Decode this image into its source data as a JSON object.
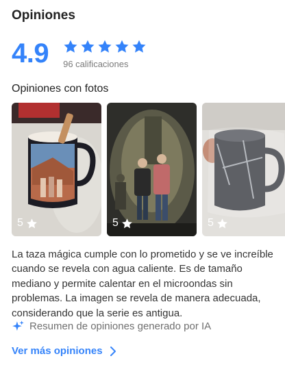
{
  "header": {
    "title": "Opiniones"
  },
  "rating": {
    "value": "4.9",
    "count_label": "96 calificaciones",
    "stars_filled": 5,
    "stars_total": 5,
    "star_color": "#3483fa"
  },
  "photos_section": {
    "title": "Opiniones con fotos",
    "photos": [
      {
        "rating": "5",
        "icon": "star-icon",
        "description_icon": "mug-photo"
      },
      {
        "rating": "5",
        "icon": "star-icon",
        "description_icon": "people-photo"
      },
      {
        "rating": "5",
        "icon": "star-icon",
        "description_icon": "wrapped-mug-photo"
      }
    ]
  },
  "review": {
    "text": "La taza mágica cumple con lo prometido y se ve increíble cuando se revela con agua caliente. Es de tamaño mediano y permite calentar en el microondas sin problemas. La imagen se revela de manera adecuada, considerando que la serie es antigua."
  },
  "ai_summary": {
    "icon": "sparkle-icon",
    "label": "Resumen de opiniones generado por IA"
  },
  "more": {
    "label": "Ver más opiniones",
    "icon": "chevron-right-icon",
    "color": "#3483fa"
  }
}
